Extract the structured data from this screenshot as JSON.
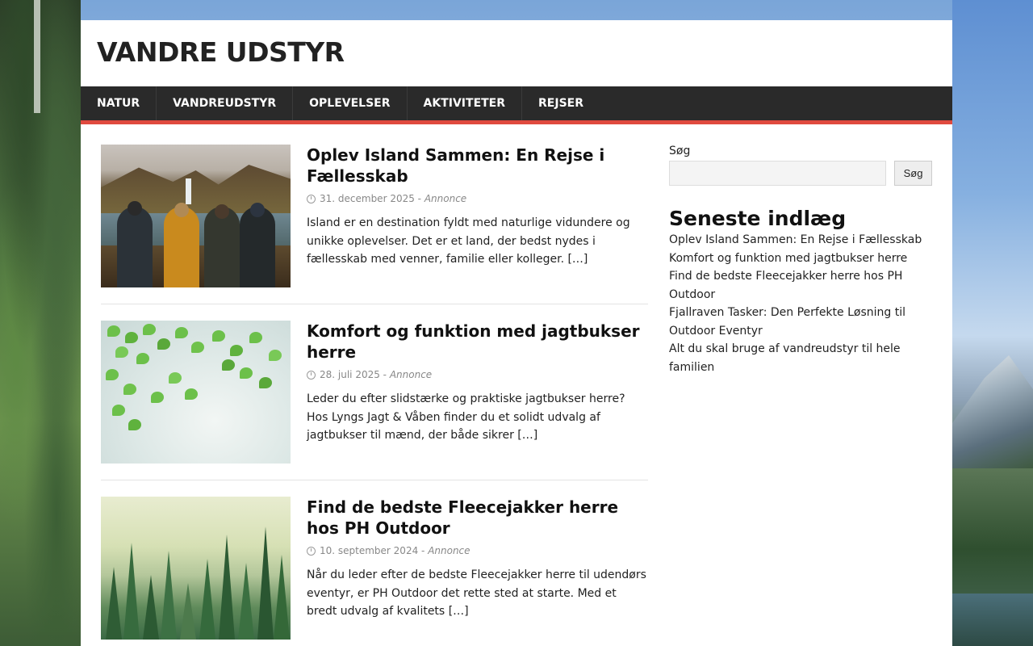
{
  "site": {
    "title": "VANDRE UDSTYR"
  },
  "nav": [
    "NATUR",
    "VANDREUDSTYR",
    "OPLEVELSER",
    "AKTIVITETER",
    "REJSER"
  ],
  "posts": [
    {
      "title": "Oplev Island Sammen: En Rejse i Fællesskab",
      "date": "31. december 2025",
      "separator": " - ",
      "author": "Annonce",
      "excerpt": "Island er en destination fyldt med naturlige vidundere og unikke oplevelser. Det er et land, der bedst nydes i fællesskab med venner, familie eller kolleger.",
      "more": "[…]"
    },
    {
      "title": "Komfort og funktion med jagtbukser herre",
      "date": "28. juli 2025",
      "separator": " - ",
      "author": "Annonce",
      "excerpt": "Leder du efter slidstærke og praktiske jagtbukser herre? Hos Lyngs Jagt & Våben finder du et solidt udvalg af jagtbukser til mænd, der både sikrer",
      "more": "[…]"
    },
    {
      "title": "Find de bedste Fleecejakker herre hos PH Outdoor",
      "date": "10. september 2024",
      "separator": " - ",
      "author": "Annonce",
      "excerpt": "Når du leder efter de bedste Fleecejakker herre til udendørs eventyr, er PH Outdoor det rette sted at starte. Med et bredt udvalg af kvalitets",
      "more": "[…]"
    }
  ],
  "sidebar": {
    "search_label": "Søg",
    "search_value": "",
    "search_button": "Søg",
    "recent_title": "Seneste indlæg",
    "recent": [
      "Oplev Island Sammen: En Rejse i Fællesskab",
      "Komfort og funktion med jagtbukser herre",
      "Find de bedste Fleecejakker herre hos PH Outdoor",
      "Fjallraven Tasker: Den Perfekte Løsning til Outdoor Eventyr",
      "Alt du skal bruge af vandreudstyr til hele familien"
    ]
  },
  "colors": {
    "nav_bg": "#2a2a2a",
    "accent": "#e04a3f"
  }
}
